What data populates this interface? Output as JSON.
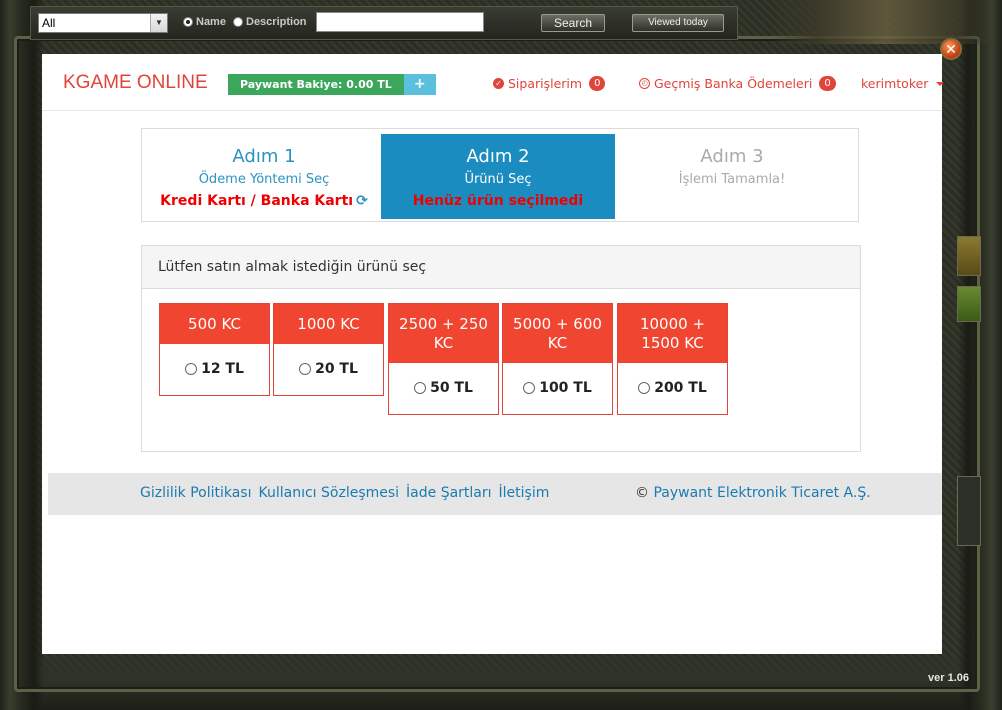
{
  "toolbar": {
    "category_select": "All",
    "radio_name": "Name",
    "radio_description": "Description",
    "search_value": "",
    "search_button": "Search",
    "viewed_today_button": "Viewed today"
  },
  "frame": {
    "version": "ver 1.06",
    "close_glyph": "✕"
  },
  "header": {
    "brand": "KGAME ONLINE",
    "balance_label": "Paywant Bakiye: 0.00 TL",
    "balance_add": "+",
    "orders_label": "Siparişlerim",
    "orders_count": "0",
    "bank_payments_label": "Geçmiş Banka Ödemeleri",
    "bank_payments_count": "0",
    "user_name": "kerimtoker"
  },
  "steps": [
    {
      "title": "Adım 1",
      "subtitle": "Ödeme Yöntemi Seç",
      "status": "Kredi Kartı / Banka Kartı"
    },
    {
      "title": "Adım 2",
      "subtitle": "Ürünü Seç",
      "status": "Henüz ürün seçilmedi"
    },
    {
      "title": "Adım 3",
      "subtitle": "İşlemi Tamamla!",
      "status": ""
    }
  ],
  "products_panel": {
    "heading": "Lütfen satın almak istediğin ürünü seç",
    "products": [
      {
        "name": "500 KC",
        "price": "12 TL"
      },
      {
        "name": "1000 KC",
        "price": "20 TL"
      },
      {
        "name": "2500 + 250 KC",
        "price": "50 TL"
      },
      {
        "name": "5000 + 600 KC",
        "price": "100 TL"
      },
      {
        "name": "10000 + 1500 KC",
        "price": "200 TL"
      }
    ]
  },
  "footer": {
    "links": [
      "Gizlilik Politikası",
      "Kullanıcı Sözleşmesi",
      "İade Şartları",
      "İletişim"
    ],
    "copyright_symbol": "©",
    "company": "Paywant Elektronik Ticaret A.Ş."
  },
  "colors": {
    "accent_red": "#e0443a",
    "step_active": "#1b8cc0",
    "balance_green": "#3aa75a",
    "link_blue": "#1b7bb0"
  }
}
